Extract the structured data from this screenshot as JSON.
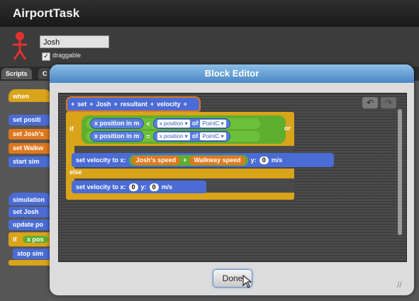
{
  "app": {
    "title": "AirportTask"
  },
  "sprite": {
    "name": "Josh",
    "draggable_checked": "✓",
    "draggable_label": "draggable"
  },
  "tabs": {
    "scripts": "Scripts",
    "costumes": "C"
  },
  "background_scripts": {
    "block1": [
      "when",
      "set positi",
      "set Josh's",
      "set Walkw",
      "start sim"
    ],
    "block2": [
      "simulation",
      "set Josh",
      "update po",
      "if",
      "x pos",
      "stop sim"
    ]
  },
  "dialog": {
    "title": "Block Editor",
    "undo_icon": "↶",
    "redo_icon": "↷",
    "done_label": "Done",
    "resize_icon": "//"
  },
  "blocks": {
    "hat": {
      "plus1": "+",
      "set": "set",
      "plus2": "+",
      "josh": "Josh",
      "plus3": "+",
      "resultant": "resultant",
      "plus4": "+",
      "velocity": "velocity",
      "plus5": "+"
    },
    "if_label": "if",
    "cond1": {
      "left": "x position in m",
      "op": "<",
      "prop": "x position",
      "of": "of",
      "obj": "PointC"
    },
    "cond2": {
      "left": "x position in m",
      "op": "=",
      "prop": "x position",
      "of": "of",
      "obj": "PointC"
    },
    "or_label": "or",
    "set_vel1": {
      "prefix": "set velocity to x:",
      "a": "Josh's speed",
      "plus": "+",
      "b": "Walkway speed",
      "y": "y:",
      "yval": "0",
      "unit": "m/s"
    },
    "else_label": "else",
    "set_vel2": {
      "prefix": "set velocity to x:",
      "xval": "0",
      "y": "y:",
      "yval": "0",
      "unit": "m/s"
    }
  }
}
